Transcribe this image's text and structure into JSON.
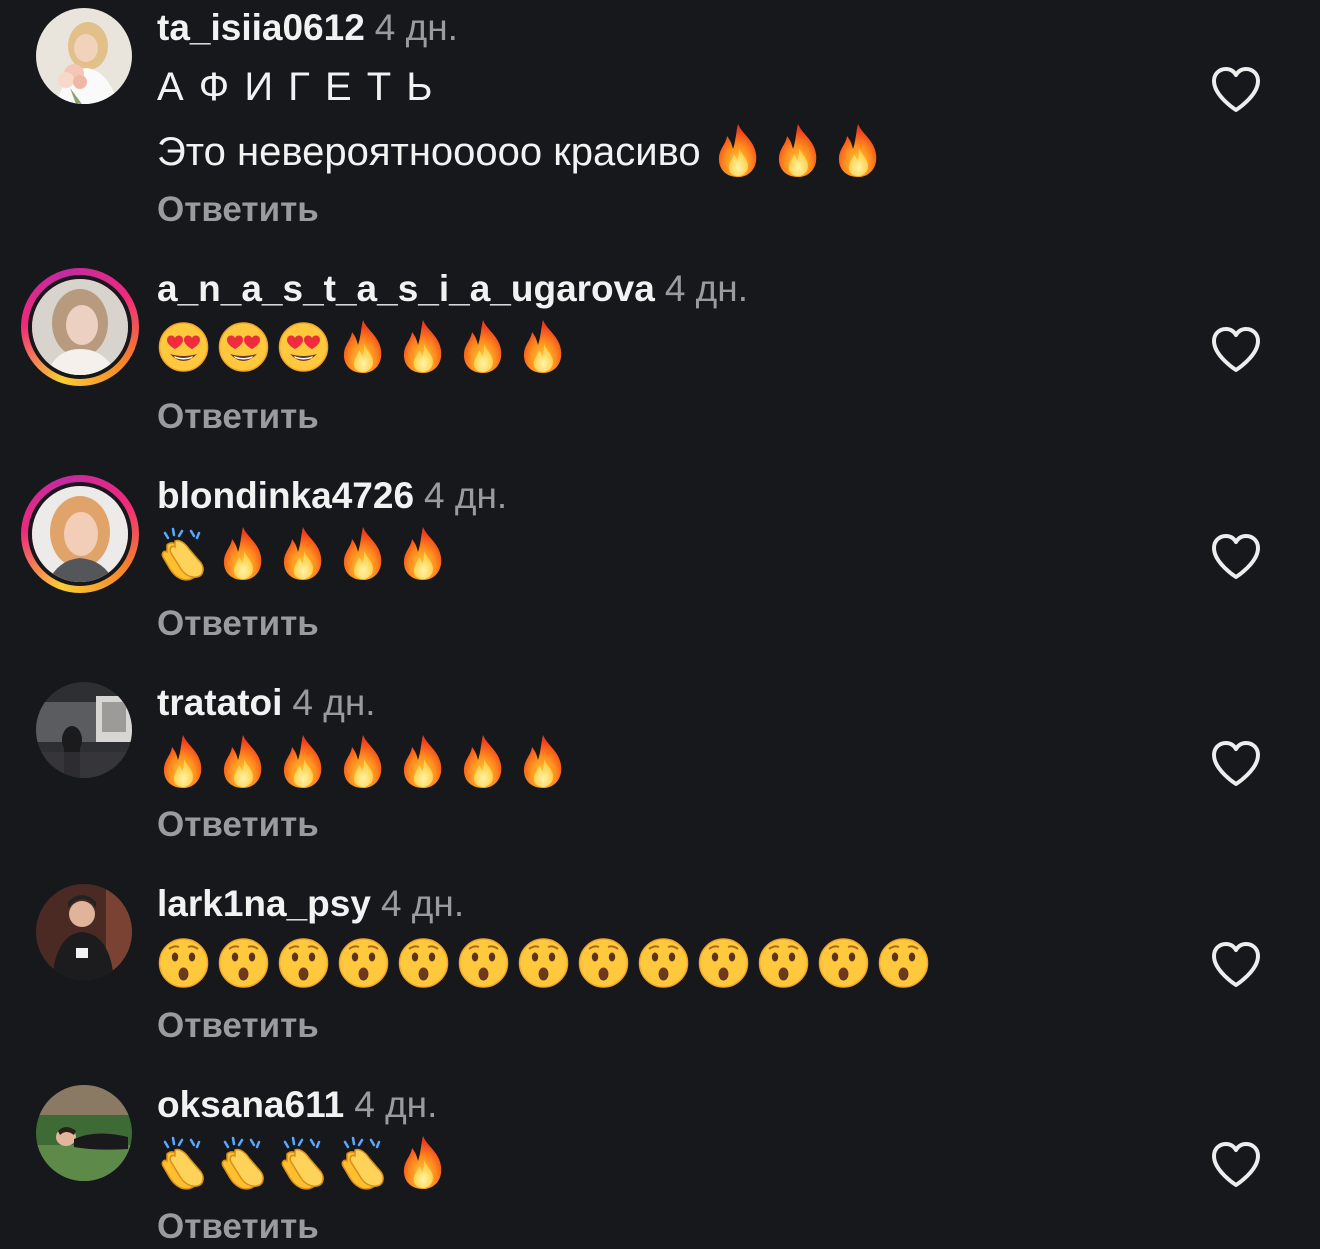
{
  "comments": [
    {
      "username": "ta_isiia0612",
      "time": "4 дн.",
      "lines": [
        "А Ф И Г Е Т Ь",
        "Это невероятнооооо красиво"
      ],
      "emojis": [
        "fire",
        "fire",
        "fire"
      ],
      "reply_label": "Ответить",
      "story_ring": false
    },
    {
      "username": "a_n_a_s_t_a_s_i_a_ugarova",
      "time": "4 дн.",
      "emojis": [
        "heart-eyes",
        "heart-eyes",
        "heart-eyes",
        "fire",
        "fire",
        "fire",
        "fire"
      ],
      "reply_label": "Ответить",
      "story_ring": true
    },
    {
      "username": "blondinka4726",
      "time": "4 дн.",
      "emojis": [
        "clap",
        "fire",
        "fire",
        "fire",
        "fire"
      ],
      "reply_label": "Ответить",
      "story_ring": true
    },
    {
      "username": "tratatoi",
      "time": "4 дн.",
      "emojis": [
        "fire",
        "fire",
        "fire",
        "fire",
        "fire",
        "fire",
        "fire"
      ],
      "reply_label": "Ответить",
      "story_ring": false
    },
    {
      "username": "lark1na_psy",
      "time": "4 дн.",
      "emojis": [
        "hushed",
        "hushed",
        "hushed",
        "hushed",
        "hushed",
        "hushed",
        "hushed",
        "hushed",
        "hushed",
        "hushed",
        "hushed",
        "hushed",
        "hushed"
      ],
      "reply_label": "Ответить",
      "story_ring": false
    },
    {
      "username": "oksana611",
      "time": "4 дн.",
      "emojis": [
        "clap",
        "clap",
        "clap",
        "clap",
        "fire"
      ],
      "reply_label": "Ответить",
      "story_ring": false
    }
  ],
  "icons": {
    "like": "heart-outline-icon",
    "fire": "fire-emoji-icon",
    "heart-eyes": "heart-eyes-emoji-icon",
    "clap": "clapping-hands-emoji-icon",
    "hushed": "hushed-face-emoji-icon"
  },
  "colors": {
    "background": "#17181c",
    "text": "#f2f2f2",
    "secondary": "#9a9ba0"
  }
}
